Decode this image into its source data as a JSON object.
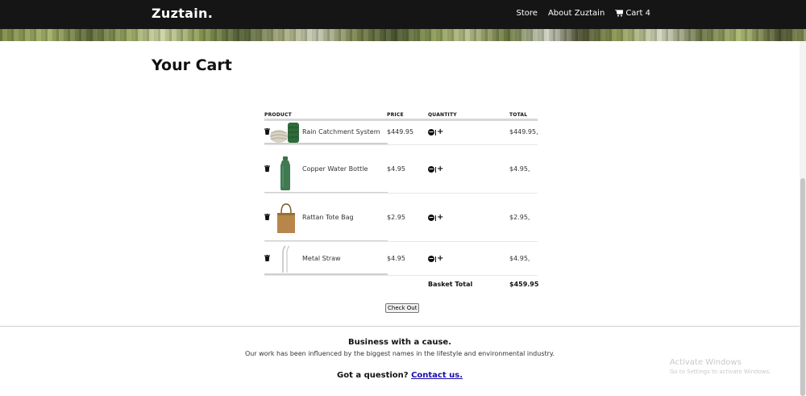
{
  "nav": {
    "brand": "Zuztain.",
    "links": [
      "Store",
      "About Zuztain"
    ],
    "cart_label": "Cart 4"
  },
  "page": {
    "title": "Your Cart"
  },
  "table": {
    "headers": [
      "PRODUCT",
      "PRICE",
      "QUANTITY",
      "TOTAL"
    ],
    "rows": [
      {
        "name": "Rain Catchment System",
        "price": "$449.95",
        "total": "$449.95,"
      },
      {
        "name": "Copper Water Bottle",
        "price": "$4.95",
        "total": "$4.95,"
      },
      {
        "name": "Rattan Tote Bag",
        "price": "$2.95",
        "total": "$2.95,"
      },
      {
        "name": "Metal Straw",
        "price": "$4.95",
        "total": "$4.95,"
      }
    ],
    "basket_label": "Basket Total",
    "basket_total": "$459.95"
  },
  "checkout": {
    "label": "Check Out"
  },
  "footer": {
    "title": "Business with a cause.",
    "subtitle": "Our work has been influenced by the biggest names in the lifestyle and environmental industry.",
    "question": "Got a question?",
    "contact": "Contact us."
  },
  "watermark": {
    "line1": "Activate Windows",
    "line2": "Go to Settings to activate Windows."
  },
  "icons": {
    "cart": "cart-icon",
    "trash": "trash-icon",
    "minus": "minus-circle-icon",
    "plus": "plus-icon"
  }
}
